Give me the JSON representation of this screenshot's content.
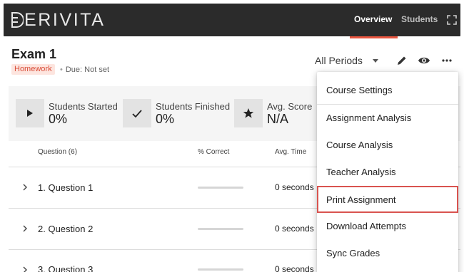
{
  "app": {
    "brand": "DERIVITA",
    "nav": [
      "Overview",
      "Students"
    ],
    "active_nav": "Overview",
    "accent_color": "#e8553f"
  },
  "assignment": {
    "title": "Exam 1",
    "type_badge": "Homework",
    "due": "Due: Not set",
    "period_select": "All Periods"
  },
  "toolbar_icons": [
    "edit-icon",
    "preview-icon",
    "more-vert-icon"
  ],
  "stats": [
    {
      "icon": "play-icon",
      "label": "Students Started",
      "value": "0%"
    },
    {
      "icon": "check-icon",
      "label": "Students Finished",
      "value": "0%"
    },
    {
      "icon": "star-icon",
      "label": "Avg. Score",
      "value": "N/A"
    }
  ],
  "table": {
    "headers": [
      "Question (6)",
      "% Correct",
      "Avg. Time"
    ],
    "rows": [
      {
        "question": "1. Question 1",
        "avg_time": "0 seconds"
      },
      {
        "question": "2. Question 2",
        "avg_time": "0 seconds"
      },
      {
        "question": "3. Question 3",
        "avg_time": "0 seconds"
      }
    ]
  },
  "menu": {
    "items": [
      "Course Settings",
      "Assignment Analysis",
      "Course Analysis",
      "Teacher Analysis",
      "Print Assignment",
      "Download Attempts",
      "Sync Grades"
    ],
    "highlighted": "Print Assignment",
    "highlight_color": "#d9534f"
  }
}
